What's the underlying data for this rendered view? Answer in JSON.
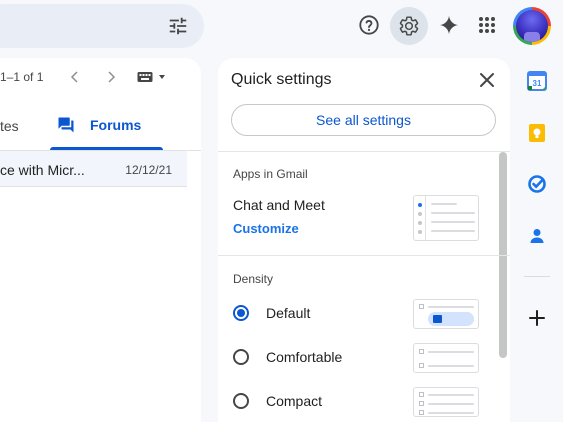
{
  "header": {
    "search_filter_icon": "tune-icon",
    "help_icon": "help-icon",
    "settings_icon": "gear-icon",
    "gemini_icon": "sparkle-icon",
    "apps_icon": "apps-grid-icon",
    "avatar_icon": "avatar"
  },
  "mail_list": {
    "pager": "1–1 of 1",
    "tabs": [
      {
        "label": "tes"
      },
      {
        "label": "Forums",
        "active": true
      }
    ],
    "rows": [
      {
        "subject": "ce with Micr...",
        "date": "12/12/21"
      }
    ]
  },
  "quick_settings": {
    "title": "Quick settings",
    "see_all_label": "See all settings",
    "apps_section": {
      "title": "Apps in Gmail",
      "label": "Chat and Meet",
      "link": "Customize"
    },
    "density_section": {
      "title": "Density",
      "options": [
        {
          "label": "Default",
          "selected": true
        },
        {
          "label": "Comfortable",
          "selected": false
        },
        {
          "label": "Compact",
          "selected": false
        }
      ]
    }
  },
  "side_rail": {
    "calendar_day": "31",
    "items": [
      "calendar-icon",
      "keep-icon",
      "tasks-icon",
      "contacts-icon"
    ],
    "add_icon": "add-icon"
  },
  "colors": {
    "accent": "#0b57d0",
    "background": "#f6f8fc",
    "selected_row": "#f2f6fc"
  }
}
